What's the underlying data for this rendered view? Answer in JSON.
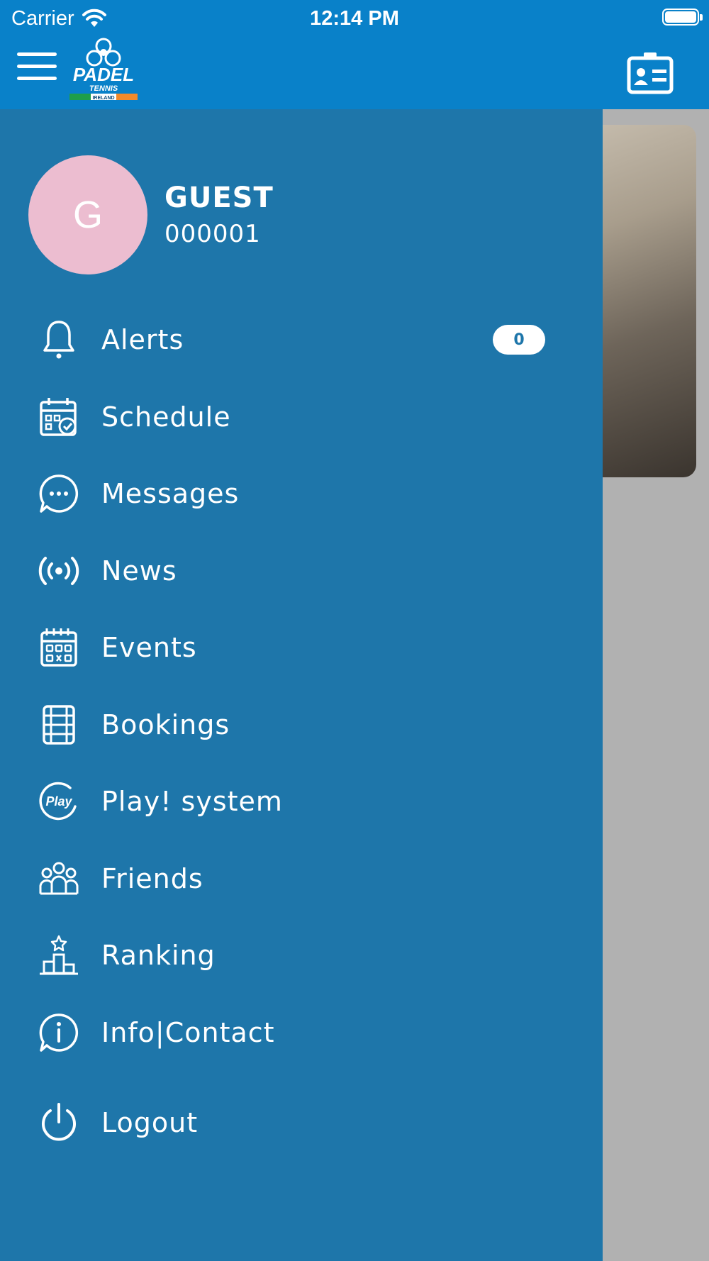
{
  "status_bar": {
    "carrier": "Carrier",
    "time": "12:14 PM"
  },
  "header": {
    "logo_text": "PADEL",
    "logo_sub": "TENNIS",
    "logo_country": "IRELAND"
  },
  "profile": {
    "avatar_letter": "G",
    "name": "GUEST",
    "id": "000001"
  },
  "menu": {
    "items": [
      {
        "label": "Alerts",
        "icon": "bell-icon",
        "badge": "0"
      },
      {
        "label": "Schedule",
        "icon": "calendar-check-icon"
      },
      {
        "label": "Messages",
        "icon": "chat-icon"
      },
      {
        "label": "News",
        "icon": "broadcast-icon"
      },
      {
        "label": "Events",
        "icon": "calendar-grid-icon"
      },
      {
        "label": "Bookings",
        "icon": "court-icon"
      },
      {
        "label": "Play! system",
        "icon": "play-logo-icon",
        "icon_text": "Play"
      },
      {
        "label": "Friends",
        "icon": "group-icon"
      },
      {
        "label": "Ranking",
        "icon": "podium-icon"
      },
      {
        "label": "Info|Contact",
        "icon": "info-chat-icon"
      },
      {
        "label": "Logout",
        "icon": "power-icon"
      }
    ]
  },
  "colors": {
    "header_bg": "#0981c9",
    "drawer_bg": "#1e76aa",
    "avatar_bg": "#ecbdd0",
    "overlay_bg": "#b1b1b1"
  }
}
